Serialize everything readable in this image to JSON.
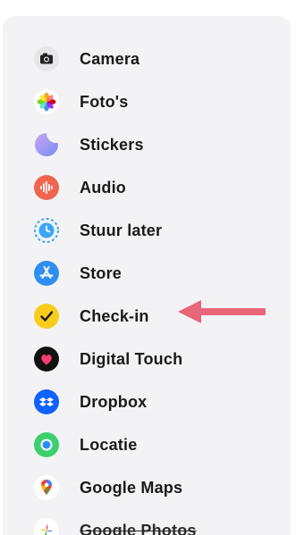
{
  "menu": {
    "items": [
      {
        "label": "Camera",
        "icon": "camera-icon"
      },
      {
        "label": "Foto's",
        "icon": "photos-icon"
      },
      {
        "label": "Stickers",
        "icon": "stickers-icon"
      },
      {
        "label": "Audio",
        "icon": "audio-icon"
      },
      {
        "label": "Stuur later",
        "icon": "send-later-icon"
      },
      {
        "label": "Store",
        "icon": "app-store-icon"
      },
      {
        "label": "Check-in",
        "icon": "check-in-icon"
      },
      {
        "label": "Digital Touch",
        "icon": "digital-touch-icon"
      },
      {
        "label": "Dropbox",
        "icon": "dropbox-icon"
      },
      {
        "label": "Locatie",
        "icon": "location-icon"
      },
      {
        "label": "Google Maps",
        "icon": "google-maps-icon"
      },
      {
        "label": "Google Photos",
        "icon": "google-photos-icon"
      }
    ]
  },
  "annotation": {
    "color": "#e8657a",
    "points_to": "Check-in"
  },
  "colors": {
    "panel_bg": "#f3f3f5",
    "text": "#1a1a1a"
  }
}
